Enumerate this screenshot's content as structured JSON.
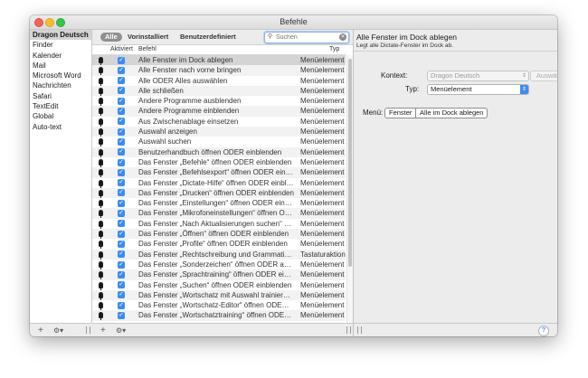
{
  "window": {
    "title": "Befehle"
  },
  "sidebar": {
    "items": [
      "Dragon Deutsch",
      "Finder",
      "Kalender",
      "Mail",
      "Microsoft Word",
      "Nachrichten",
      "Safari",
      "TextEdit",
      "Global",
      "Auto-text"
    ],
    "selected_index": 0
  },
  "filter": {
    "tabs": [
      "Alle",
      "Vorinstalliert",
      "Benutzerdefiniert"
    ],
    "active_index": 0,
    "search_placeholder": "Suchen"
  },
  "table": {
    "headers": {
      "enabled": "Aktiviert",
      "command": "Befehl",
      "type": "Typ"
    },
    "rows": [
      {
        "command": "Alle Fenster im Dock ablegen",
        "type": "Menüelement"
      },
      {
        "command": "Alle Fenster nach vorne bringen",
        "type": "Menüelement"
      },
      {
        "command": "Alle ODER Alles auswählen",
        "type": "Menüelement"
      },
      {
        "command": "Alle schließen",
        "type": "Menüelement"
      },
      {
        "command": "Andere Programme ausblenden",
        "type": "Menüelement"
      },
      {
        "command": "Andere Programme einblenden",
        "type": "Menüelement"
      },
      {
        "command": "Aus Zwischenablage einsetzen",
        "type": "Menüelement"
      },
      {
        "command": "Auswahl anzeigen",
        "type": "Menüelement"
      },
      {
        "command": "Auswahl suchen",
        "type": "Menüelement"
      },
      {
        "command": "Benutzerhandbuch öffnen ODER einblenden",
        "type": "Menüelement"
      },
      {
        "command": "Das Fenster „Befehle“ öffnen ODER einblenden",
        "type": "Menüelement"
      },
      {
        "command": "Das Fenster „Befehlsexport“ öffnen ODER einbl…",
        "type": "Menüelement"
      },
      {
        "command": "Das Fenster „Dictate-Hilfe“ öffnen ODER einble…",
        "type": "Menüelement"
      },
      {
        "command": "Das Fenster „Drucken“ öffnen ODER einblenden",
        "type": "Menüelement"
      },
      {
        "command": "Das Fenster „Einstellungen“ öffnen ODER einbl…",
        "type": "Menüelement"
      },
      {
        "command": "Das Fenster „Mikrofoneinstellungen“ öffnen OD…",
        "type": "Menüelement"
      },
      {
        "command": "Das Fenster „Nach Aktualisierungen suchen“ ö…",
        "type": "Menüelement"
      },
      {
        "command": "Das Fenster „Öffnen“ öffnen ODER einblenden",
        "type": "Menüelement"
      },
      {
        "command": "Das Fenster „Profile“ öffnen ODER einblenden",
        "type": "Menüelement"
      },
      {
        "command": "Das Fenster „Rechtschreibung und Grammatik“…",
        "type": "Tastaturaktion"
      },
      {
        "command": "Das Fenster „Sonderzeichen“ öffnen ODER anz…",
        "type": "Menüelement"
      },
      {
        "command": "Das Fenster „Sprachtraining“ öffnen ODER ein…",
        "type": "Menüelement"
      },
      {
        "command": "Das Fenster „Suchen“ öffnen ODER einblenden",
        "type": "Menüelement"
      },
      {
        "command": "Das Fenster „Wortschatz mit Auswahl trainiere…",
        "type": "Menüelement"
      },
      {
        "command": "Das Fenster „Wortschatz-Editor“ öffnen ODER…",
        "type": "Menüelement"
      },
      {
        "command": "Das Fenster „Wortschatztraining“ öffnen ODER…",
        "type": "Menüelement"
      }
    ],
    "selected_index": 0
  },
  "detail": {
    "title": "Alle Fenster im Dock ablegen",
    "subtitle": "Legt alle Dictate-Fenster im Dock ab.",
    "kontext_label": "Kontext:",
    "kontext_value": "Dragon Deutsch",
    "choose_button": "Auswählen…",
    "typ_label": "Typ:",
    "typ_value": "Menüelement",
    "menu_label": "Menü:",
    "menu_path": [
      "Fenster",
      "Alle im Dock ablegen"
    ]
  },
  "footer": {
    "add_symbol": "+",
    "gear_symbol": "⚙▾",
    "help_symbol": "?"
  },
  "colors": {
    "accent": "#3a8cf5",
    "selection": "#d4d4d4",
    "alt_row": "#f2f2f2"
  },
  "icons": {
    "row_icon": "microphone-icon",
    "check_icon": "checkmark-icon"
  }
}
